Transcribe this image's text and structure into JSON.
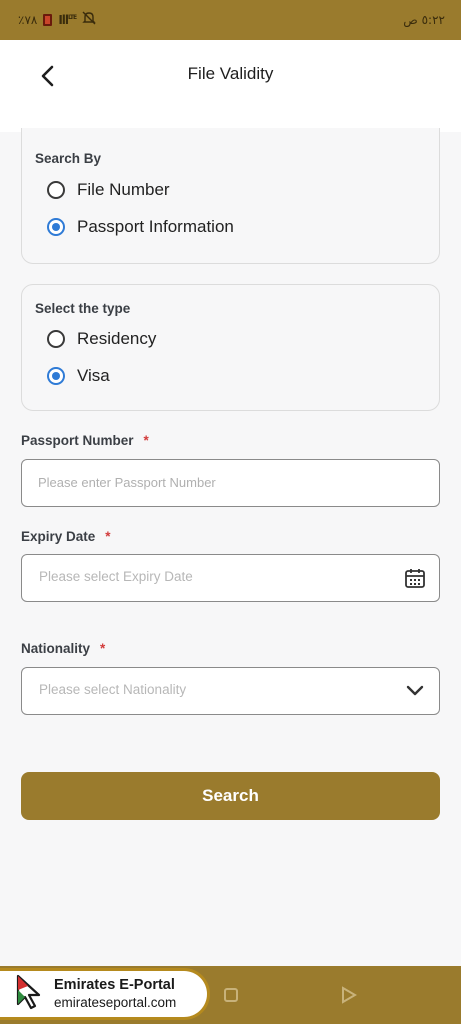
{
  "status_bar": {
    "battery_text": "٪٧٨",
    "signal_text": "LTE",
    "time": "٥:٢٢ ص"
  },
  "header": {
    "title": "File Validity",
    "back_icon": "chevron-left-icon"
  },
  "search_by": {
    "label": "Search By",
    "options": [
      {
        "label": "File Number",
        "selected": false
      },
      {
        "label": "Passport Information",
        "selected": true
      }
    ]
  },
  "select_type": {
    "label": "Select the type",
    "options": [
      {
        "label": "Residency",
        "selected": false
      },
      {
        "label": "Visa",
        "selected": true
      }
    ]
  },
  "fields": {
    "passport": {
      "label": "Passport Number",
      "required_mark": "*",
      "placeholder": "Please enter Passport Number",
      "value": ""
    },
    "expiry": {
      "label": "Expiry Date",
      "required_mark": "*",
      "placeholder": "Please select Expiry Date",
      "icon": "calendar-icon"
    },
    "nationality": {
      "label": "Nationality",
      "required_mark": "*",
      "placeholder": "Please select Nationality",
      "icon": "chevron-down-icon"
    }
  },
  "search_button": {
    "label": "Search"
  },
  "watermark": {
    "title": "Emirates E-Portal",
    "url": "emirateseportal.com"
  },
  "colors": {
    "brand": "#9a7b2d",
    "radio_selected": "#2f7bd6",
    "required": "#d23b3b"
  }
}
